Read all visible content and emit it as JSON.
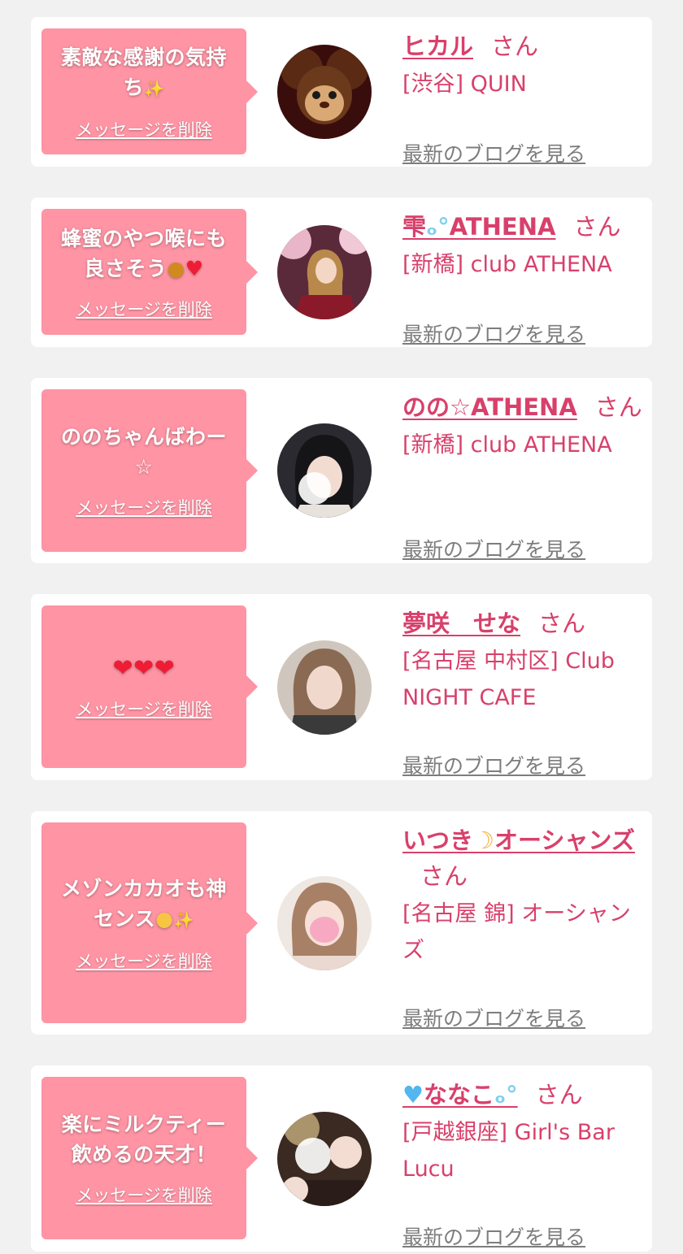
{
  "san_label": "さん",
  "delete_label": "メッセージを削除",
  "blog_label": "最新のブログを見る",
  "colors": {
    "background": "#f1f1f1",
    "card": "#ffffff",
    "bubble": "#fe94a4",
    "name_pink": "#d8406b",
    "link_gray": "#7d7d7d"
  },
  "messages": [
    {
      "message_lines": [
        "素敵な感謝の気持",
        "ち"
      ],
      "message_emoji": "sparkle",
      "name": "ヒカル",
      "shop": "[渋谷] QUIN"
    },
    {
      "message_lines": [
        "蜂蜜のやつ喉にも",
        "良さそう"
      ],
      "message_emoji": "honey-pot, heart",
      "name": "雫",
      "name_emoji": "bubbles",
      "name_suffix": "ATHENA",
      "shop": "[新橋] club ATHENA"
    },
    {
      "message_lines": [
        "ののちゃんばわー",
        "☆"
      ],
      "name": "のの☆ATHENA",
      "shop": "[新橋] club ATHENA"
    },
    {
      "message_lines": [
        "❤❤❤"
      ],
      "name": "夢咲　せな",
      "shop": "[名古屋 中村区] Club NIGHT CAFE"
    },
    {
      "message_lines": [
        "メゾンカカオも神",
        "センス"
      ],
      "message_emoji": "pleading-face, sparkle",
      "name": "いつき",
      "name_emoji": "crescent-moon",
      "name_suffix": "オーシャンズ",
      "shop": "[名古屋 錦] オーシャンズ"
    },
    {
      "message_lines": [
        "楽にミルクティー",
        "飲めるの天才！"
      ],
      "name": "ななこ",
      "name_emoji": "blue-heart, bubbles",
      "shop": "[戸越銀座] Girl's Bar Lucu"
    }
  ]
}
